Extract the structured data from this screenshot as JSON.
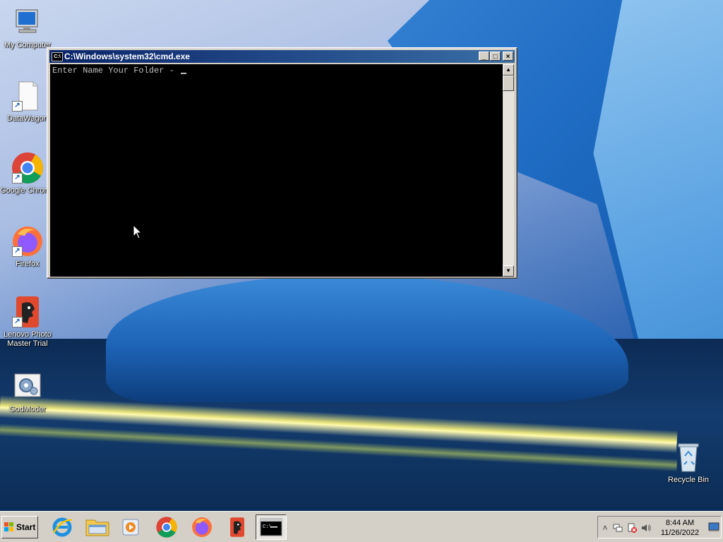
{
  "desktop": {
    "icons": [
      {
        "label": "My Computer",
        "icon": "my-computer-icon"
      },
      {
        "label": "DataWagon",
        "icon": "file-shortcut-icon"
      },
      {
        "label": "Google Chrome",
        "icon": "chrome-icon"
      },
      {
        "label": "Firefox",
        "icon": "firefox-icon"
      },
      {
        "label": "Lenovo Photo Master Trial",
        "icon": "lenovo-photo-master-icon"
      },
      {
        "label": "GodModer",
        "icon": "godmode-icon"
      },
      {
        "label": "Recycle Bin",
        "icon": "recycle-bin-icon"
      }
    ]
  },
  "cmd_window": {
    "title": "C:\\Windows\\system32\\cmd.exe",
    "title_icon_text": "C:\\",
    "console_text": "Enter Name Your Folder - ",
    "minimize": "_",
    "maximize": "□",
    "close": "×"
  },
  "taskbar": {
    "start_label": "Start",
    "items": [
      {
        "name": "internet-explorer-icon"
      },
      {
        "name": "file-explorer-icon"
      },
      {
        "name": "media-player-icon"
      },
      {
        "name": "chrome-icon"
      },
      {
        "name": "firefox-icon"
      },
      {
        "name": "lenovo-photo-master-icon"
      },
      {
        "name": "cmd-icon",
        "active": true
      }
    ],
    "tray": {
      "time": "8:44 AM",
      "date": "11/26/2022",
      "chevron": "˄"
    }
  }
}
